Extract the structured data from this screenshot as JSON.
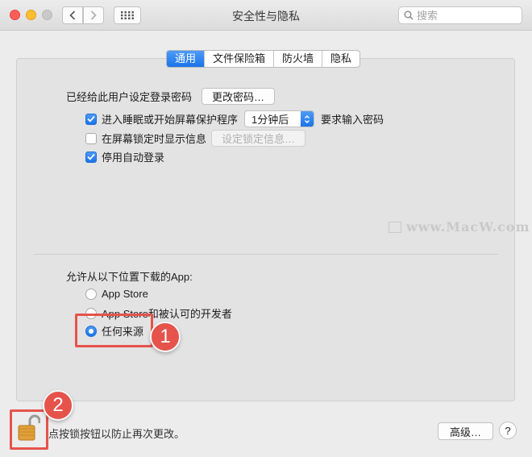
{
  "window": {
    "title": "安全性与隐私",
    "search_placeholder": "搜索"
  },
  "tabs": [
    {
      "label": "通用",
      "active": true
    },
    {
      "label": "文件保险箱",
      "active": false
    },
    {
      "label": "防火墙",
      "active": false
    },
    {
      "label": "隐私",
      "active": false
    }
  ],
  "general": {
    "password_label": "已经给此用户设定登录密码",
    "change_password_button": "更改密码…",
    "sleep_checkbox": {
      "label": "进入睡眠或开始屏幕保护程序",
      "checked": true
    },
    "sleep_delay_value": "1分钟后",
    "require_password_label": "要求输入密码",
    "lock_message_checkbox": {
      "label": "在屏幕锁定时显示信息",
      "checked": false
    },
    "set_lock_message_button": "设定锁定信息…",
    "disable_autologin_checkbox": {
      "label": "停用自动登录",
      "checked": true
    }
  },
  "downloads": {
    "heading": "允许从以下位置下载的App:",
    "options": [
      {
        "label": "App Store",
        "selected": false
      },
      {
        "label": "App Store和被认可的开发者",
        "selected": false
      },
      {
        "label": "任何来源",
        "selected": true
      }
    ]
  },
  "annotations": {
    "badge_1": "1",
    "badge_2": "2",
    "accent_color": "#e5534b"
  },
  "watermark": "www.MacW.com",
  "footer": {
    "lock_text": "点按锁按钮以防止再次更改。",
    "advanced_button": "高级…",
    "help_button": "?"
  },
  "colors": {
    "accent_blue": "#1a74e8",
    "panel_bg": "#e3e3e3",
    "window_bg": "#ececec"
  }
}
